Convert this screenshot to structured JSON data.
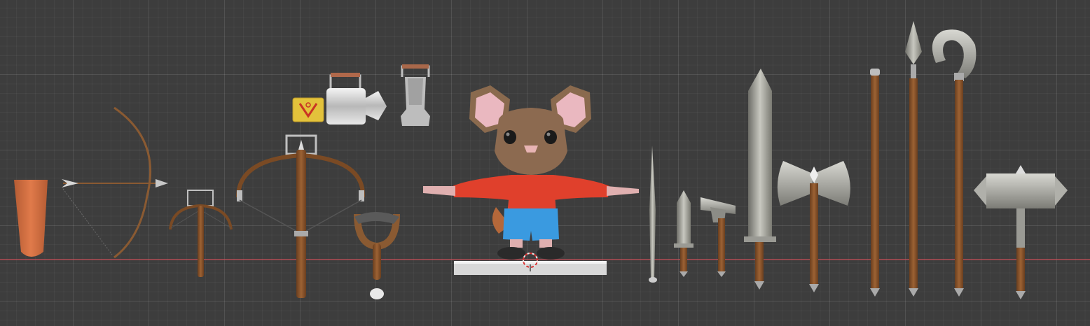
{
  "viewport": {
    "background": "#3d3d3d",
    "x_axis_color": "#c8505a",
    "objects": [
      "clay-cup-icon",
      "bow-and-arrow-icon",
      "small-crossbow-icon",
      "large-crossbow-icon",
      "warning-sign-icon",
      "spray-canister-icon",
      "glitter-canister-icon",
      "slingshot-icon",
      "mouse-character-icon",
      "needle-icon",
      "dagger-icon",
      "hammer-icon",
      "sword-icon",
      "battle-axe-icon",
      "staff-icon",
      "spear-icon",
      "crook-staff-icon",
      "war-hammer-icon",
      "3d-cursor-icon"
    ]
  }
}
